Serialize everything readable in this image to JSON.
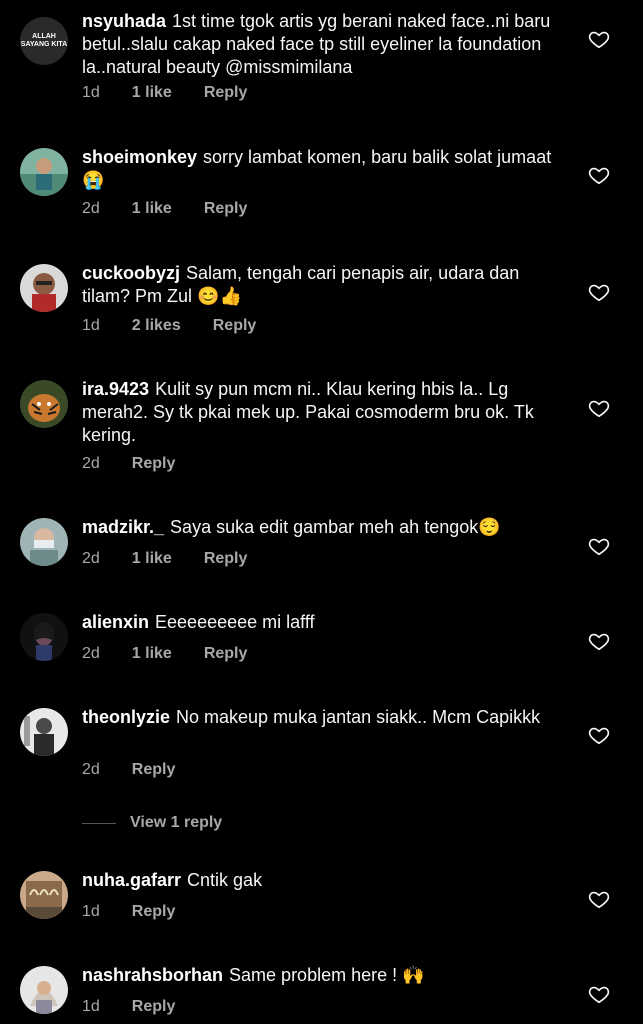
{
  "comments": [
    {
      "username": "nsyuhada",
      "text": "1st time tgok artis yg berani naked face..ni baru betul..slalu cakap naked face tp still eyeliner la foundation la..natural beauty ",
      "mention": "@missmimilana",
      "time": "1d",
      "likes": "1 like",
      "reply": "Reply",
      "avatar_text": "ALLAH SAYANG KITA"
    },
    {
      "username": "shoeimonkey",
      "text": "sorry lambat komen, baru balik solat jumaat",
      "emoji": "😭",
      "time": "2d",
      "likes": "1 like",
      "reply": "Reply"
    },
    {
      "username": "cuckoobyzj",
      "text": "Salam, tengah cari penapis air, udara dan tilam? Pm Zul ",
      "emoji": "😊👍",
      "time": "1d",
      "likes": "2 likes",
      "reply": "Reply"
    },
    {
      "username": "ira.9423",
      "text": "Kulit sy pun mcm ni.. Klau kering hbis la.. Lg merah2. Sy tk pkai mek up. Pakai cosmoderm bru ok. Tk kering.",
      "time": "2d",
      "reply": "Reply"
    },
    {
      "username": "madzikr._",
      "text": "Saya suka edit gambar meh ah tengok",
      "emoji": "😌",
      "time": "2d",
      "likes": "1 like",
      "reply": "Reply"
    },
    {
      "username": "alienxin",
      "text": "Eeeeeeeeee mi lafff",
      "time": "2d",
      "likes": "1 like",
      "reply": "Reply"
    },
    {
      "username": "theonlyzie",
      "text": "No makeup muka jantan siakk.. Mcm Capikkk",
      "time": "2d",
      "reply": "Reply"
    },
    {
      "username": "nuha.gafarr",
      "text": "Cntik gak",
      "time": "1d",
      "reply": "Reply"
    },
    {
      "username": "nashrahsborhan",
      "text": "Same problem here ! ",
      "emoji": "🙌",
      "time": "1d",
      "reply": "Reply"
    }
  ],
  "view_replies": "View 1 reply",
  "colors": {
    "background": "#000000",
    "text": "#f5f5f5",
    "meta": "#a8a8a8"
  }
}
